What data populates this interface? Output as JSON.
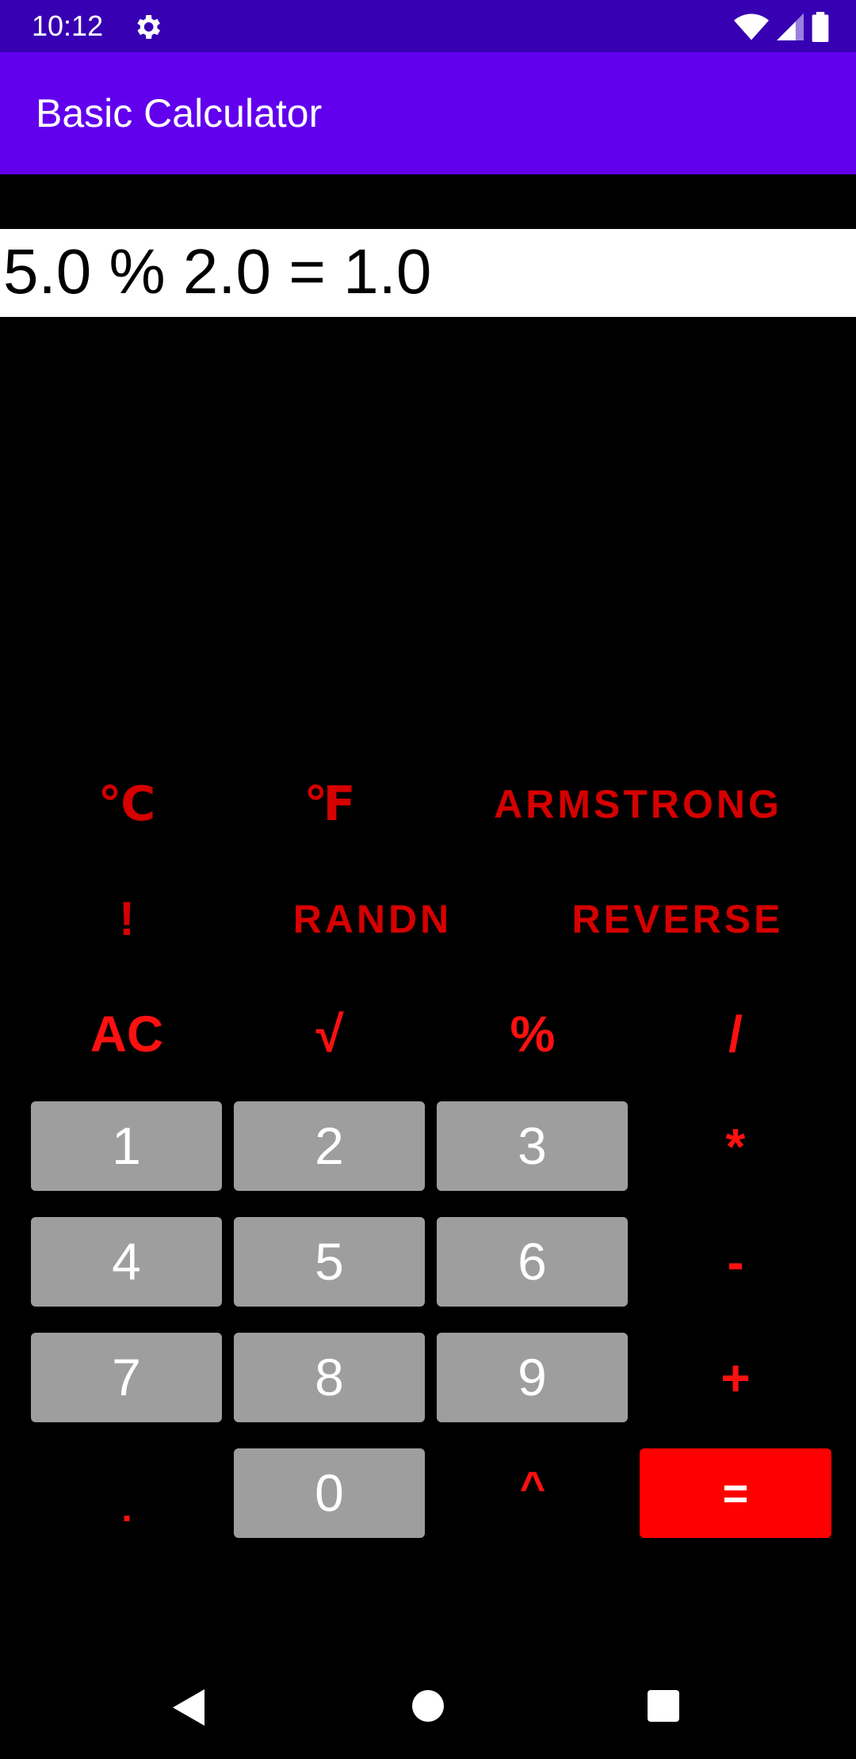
{
  "status_bar": {
    "time": "10:12",
    "icons": [
      "gear-icon",
      "wifi-icon",
      "signal-icon",
      "battery-icon"
    ],
    "bg_color": "#3700B3"
  },
  "app_bar": {
    "title": "Basic Calculator",
    "bg_color": "#6200EE"
  },
  "display": {
    "expression": "5.0 % 2.0 = 1.0"
  },
  "scientific_row1": {
    "celsius": "℃",
    "fahrenheit": "℉",
    "armstrong": "ARMSTRONG"
  },
  "scientific_row2": {
    "factorial": "!",
    "randn": "RANDN",
    "reverse": "REVERSE"
  },
  "operators": {
    "clear": "AC",
    "sqrt": "√",
    "percent": "%",
    "divide": "/",
    "multiply": "*",
    "minus": "-",
    "plus": "+",
    "dot": ".",
    "power": "^",
    "equals": "="
  },
  "digits": {
    "d1": "1",
    "d2": "2",
    "d3": "3",
    "d4": "4",
    "d5": "5",
    "d6": "6",
    "d7": "7",
    "d8": "8",
    "d9": "9",
    "d0": "0"
  },
  "colors": {
    "accent_red": "#FF0000",
    "label_red": "#D50000",
    "digit_bg": "#9E9E9E"
  },
  "nav_bar": {
    "icons": [
      "back-icon",
      "home-icon",
      "recents-icon"
    ]
  }
}
